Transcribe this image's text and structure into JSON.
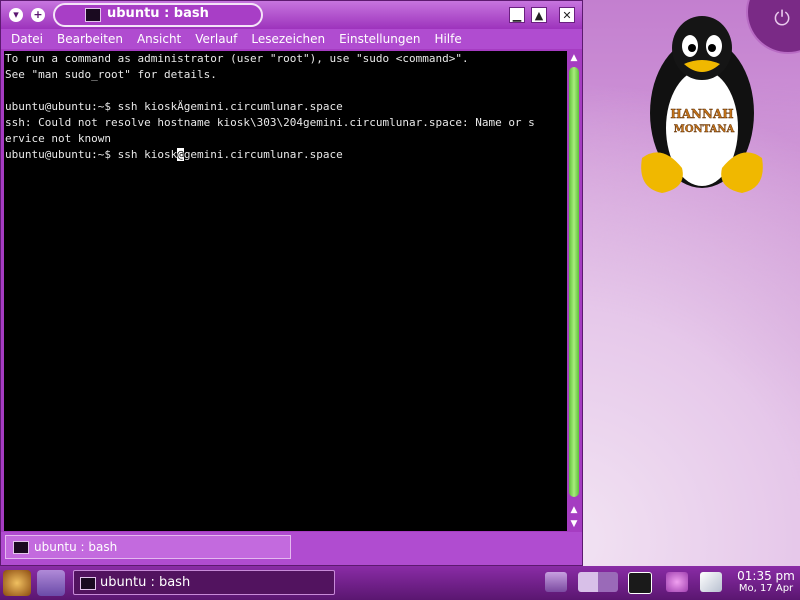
{
  "window": {
    "title": "ubuntu : bash",
    "menu": [
      "Datei",
      "Bearbeiten",
      "Ansicht",
      "Verlauf",
      "Lesezeichen",
      "Einstellungen",
      "Hilfe"
    ]
  },
  "terminal": {
    "lines": [
      "To run a command as administrator (user \"root\"), use \"sudo <command>\".",
      "See \"man sudo_root\" for details.",
      "",
      "ubuntu@ubuntu:~$ ssh kioskÄgemini.circumlunar.space",
      "ssh: Could not resolve hostname kiosk\\303\\204gemini.circumlunar.space: Name or s",
      "ervice not known"
    ],
    "prompt_before_cursor": "ubuntu@ubuntu:~$ ssh kiosk",
    "cursor_char": "@",
    "prompt_after_cursor": "gemini.circumlunar.space"
  },
  "tab": {
    "label": "ubuntu : bash"
  },
  "taskbar": {
    "task_label": "ubuntu : bash",
    "clock_time": "01:35 pm",
    "clock_date": "Mo, 17 Apr"
  },
  "desktop": {
    "logo_line1": "HANNAH",
    "logo_line2": "MONTANA"
  },
  "colors": {
    "window_frame": "#a63cc2",
    "terminal_bg": "#000000",
    "scroll_thumb": "#7fd64e",
    "taskbar": "#6a1d82"
  }
}
